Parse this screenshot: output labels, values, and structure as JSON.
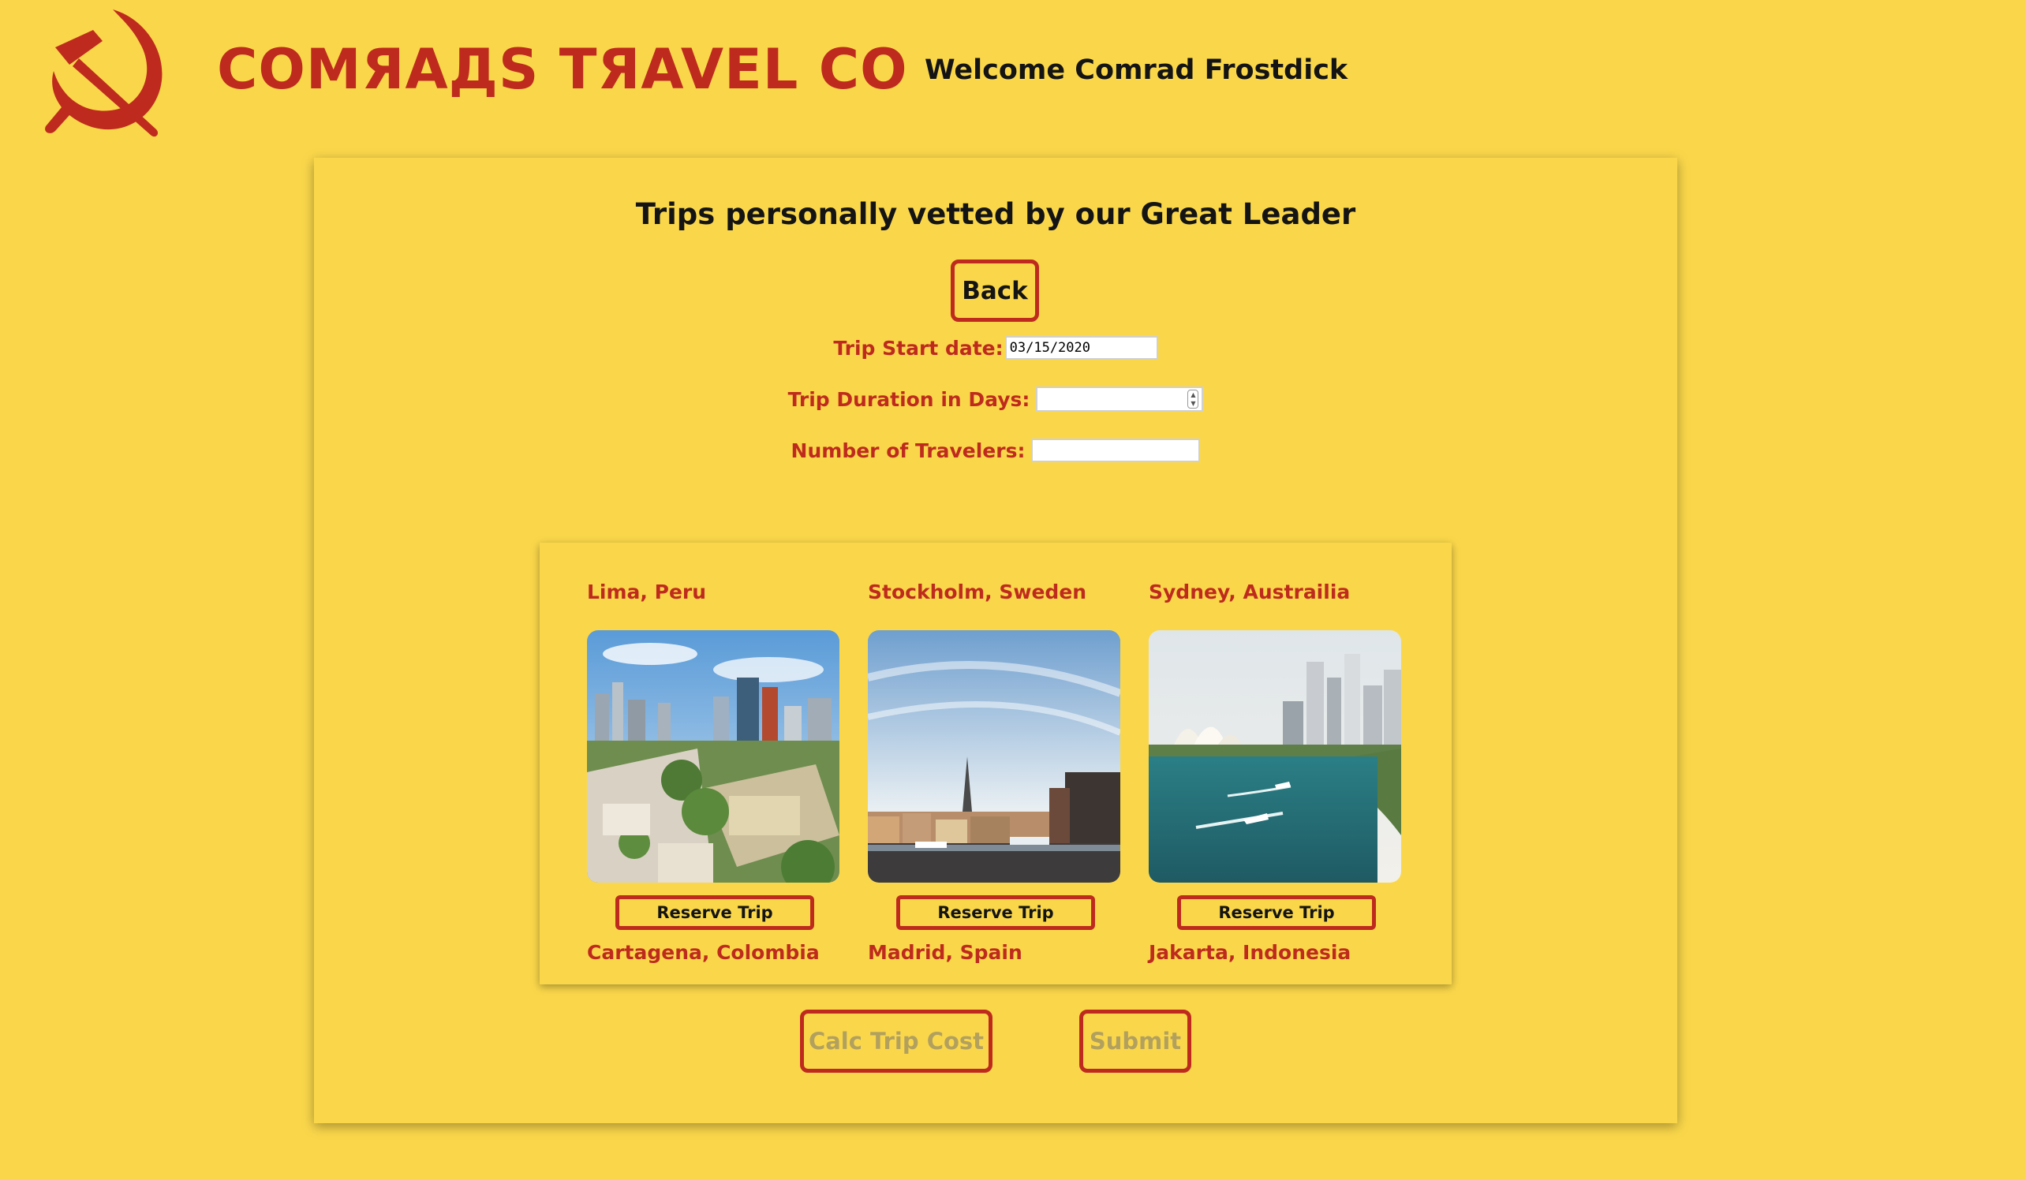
{
  "header": {
    "brand": "COMЯAДS TЯAVEL CO",
    "welcome": "Welcome Comrad Frostdick",
    "logo_icon": "hammer-and-sickle-icon"
  },
  "colors": {
    "background": "#fad74a",
    "accent_red": "#be2b1e",
    "text_dark": "#141414",
    "disabled_text": "#b2a05e"
  },
  "panel": {
    "title": "Trips personally vetted by our Great Leader",
    "back_label": "Back"
  },
  "form": {
    "start_date_label": "Trip Start date:",
    "start_date_value": "03/15/2020",
    "duration_label": "Trip Duration in Days:",
    "duration_value": "",
    "travelers_label": "Number of Travelers:",
    "travelers_value": ""
  },
  "trips": {
    "top_row": [
      "Lima, Peru",
      "Stockholm, Sweden",
      "Sydney, Austrailia"
    ],
    "reserve_label": "Reserve Trip",
    "bottom_row": [
      "Cartagena, Colombia",
      "Madrid, Spain",
      "Jakarta, Indonesia"
    ]
  },
  "actions": {
    "calc_label": "Calc Trip Cost",
    "submit_label": "Submit"
  }
}
